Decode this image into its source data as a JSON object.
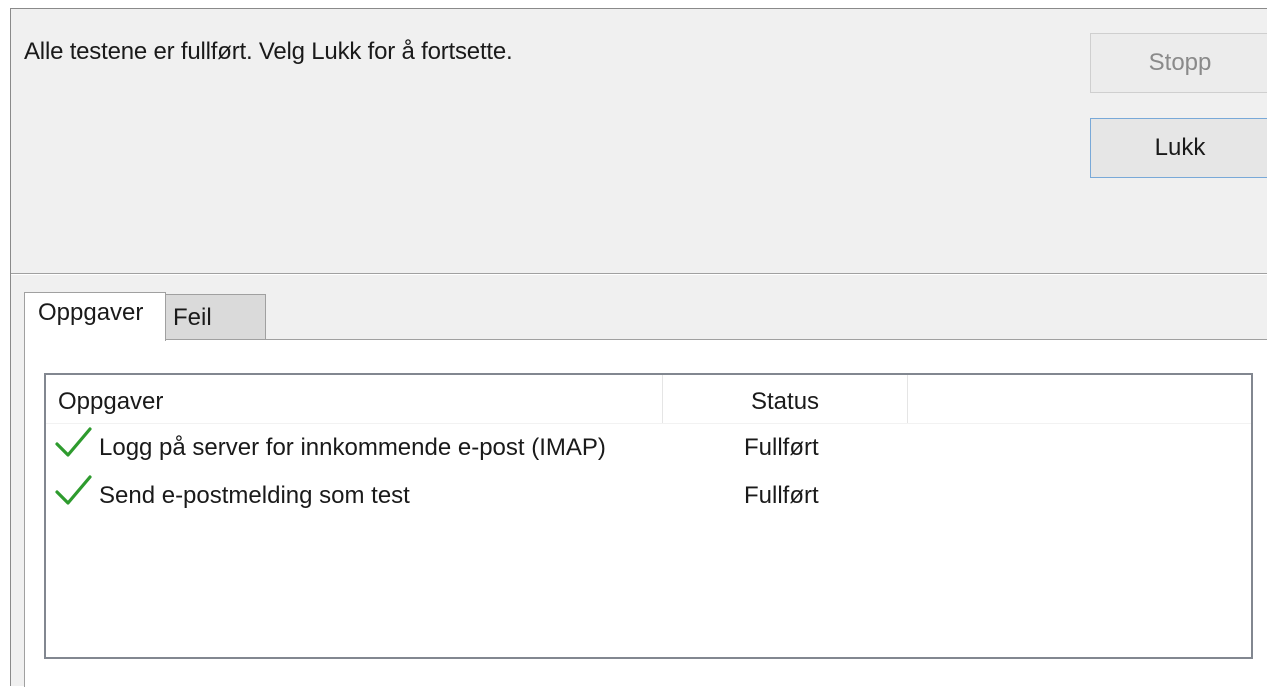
{
  "message": "Alle testene er fullført. Velg Lukk for å fortsette.",
  "buttons": {
    "stop": "Stopp",
    "close": "Lukk"
  },
  "tabs": [
    {
      "label": "Oppgaver",
      "active": true
    },
    {
      "label": "Feil",
      "active": false
    }
  ],
  "table": {
    "columns": [
      "Oppgaver",
      "Status"
    ],
    "rows": [
      {
        "icon": "checkmark-icon",
        "task": "Logg på server for innkommende e-post (IMAP)",
        "status": "Fullført"
      },
      {
        "icon": "checkmark-icon",
        "task": "Send e-postmelding som test",
        "status": "Fullført"
      }
    ]
  },
  "colors": {
    "check": "#2e9b2e",
    "dialog_bg": "#f0f0f0",
    "button_focus_border": "#79a9d8"
  }
}
